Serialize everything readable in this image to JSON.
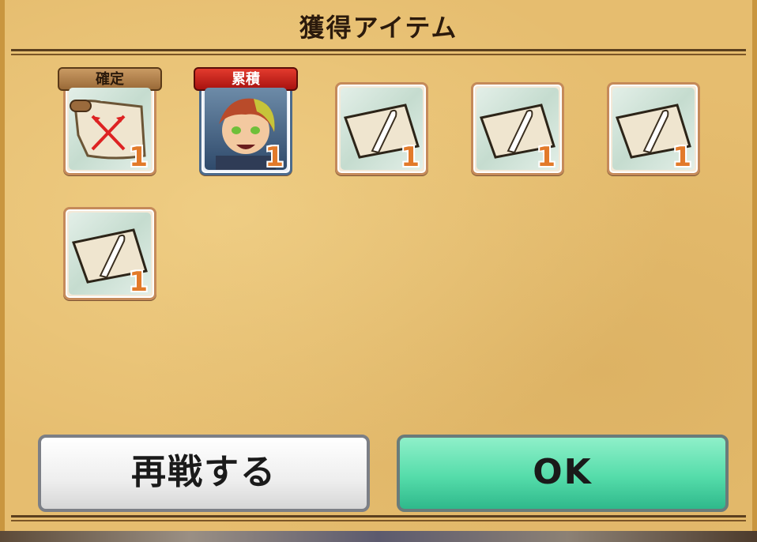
{
  "title": "獲得アイテム",
  "items": [
    {
      "name": "scroll-crossed-arrows",
      "banner": "確定",
      "count": "1"
    },
    {
      "name": "character-portrait",
      "banner": "累積",
      "count": "1"
    },
    {
      "name": "paper-feather",
      "banner": "",
      "count": "1"
    },
    {
      "name": "paper-feather",
      "banner": "",
      "count": "1"
    },
    {
      "name": "paper-feather",
      "banner": "",
      "count": "1"
    },
    {
      "name": "paper-feather",
      "banner": "",
      "count": "1"
    }
  ],
  "buttons": {
    "rematch": "再戦する",
    "ok": "OK"
  },
  "colors": {
    "panel": "#e6bd6f",
    "ok": "#55dcaa",
    "count": "#e27a2a",
    "ruiseki": "#d02a20"
  }
}
